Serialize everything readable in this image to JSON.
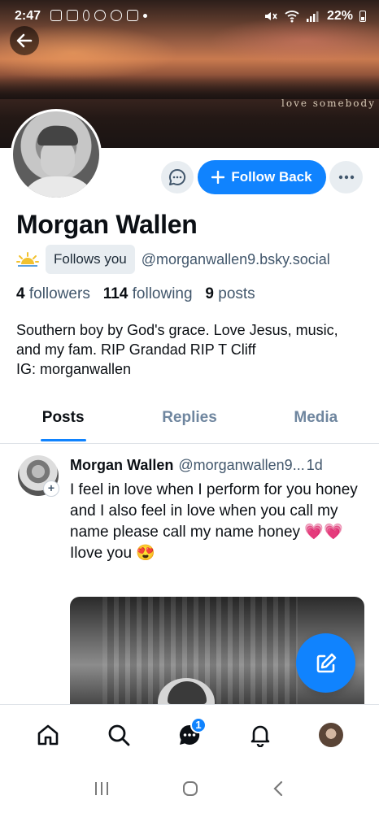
{
  "status_bar": {
    "time": "2:47",
    "battery": "22%"
  },
  "banner": {
    "caption": "love somebody"
  },
  "profile": {
    "display_name": "Morgan Wallen",
    "follows_you": "Follows you",
    "handle": "@morganwallen9.bsky.social",
    "stats": {
      "followers_count": "4",
      "followers_label": "followers",
      "following_count": "114",
      "following_label": "following",
      "posts_count": "9",
      "posts_label": "posts"
    },
    "bio": "Southern boy by God's grace. Love Jesus, music, and my fam. RIP Grandad RIP T Cliff\nIG: morganwallen",
    "follow_button_label": "Follow Back"
  },
  "tabs": [
    "Posts",
    "Replies",
    "Media"
  ],
  "active_tab": "Posts",
  "post": {
    "author": "Morgan Wallen",
    "handle": "@morganwallen9...",
    "time": "1d",
    "text": "I feel in love when I perform for you honey and I also feel in love when you call my name please call my name honey 💗💗\nIlove you 😍"
  },
  "bottom_nav": {
    "chat_badge": "1"
  },
  "colors": {
    "accent": "#1083fe",
    "text_secondary": "#42576c",
    "chip_bg": "#e8edf1"
  },
  "icons": {
    "back": "arrow-left-icon",
    "message": "chat-bubble-icon",
    "follow": "plus-icon",
    "more": "ellipsis-icon",
    "sun": "sunrise-icon",
    "compose": "pencil-square-icon",
    "home": "home-icon",
    "search": "search-icon",
    "chat": "chat-icon",
    "notifications": "bell-icon"
  }
}
